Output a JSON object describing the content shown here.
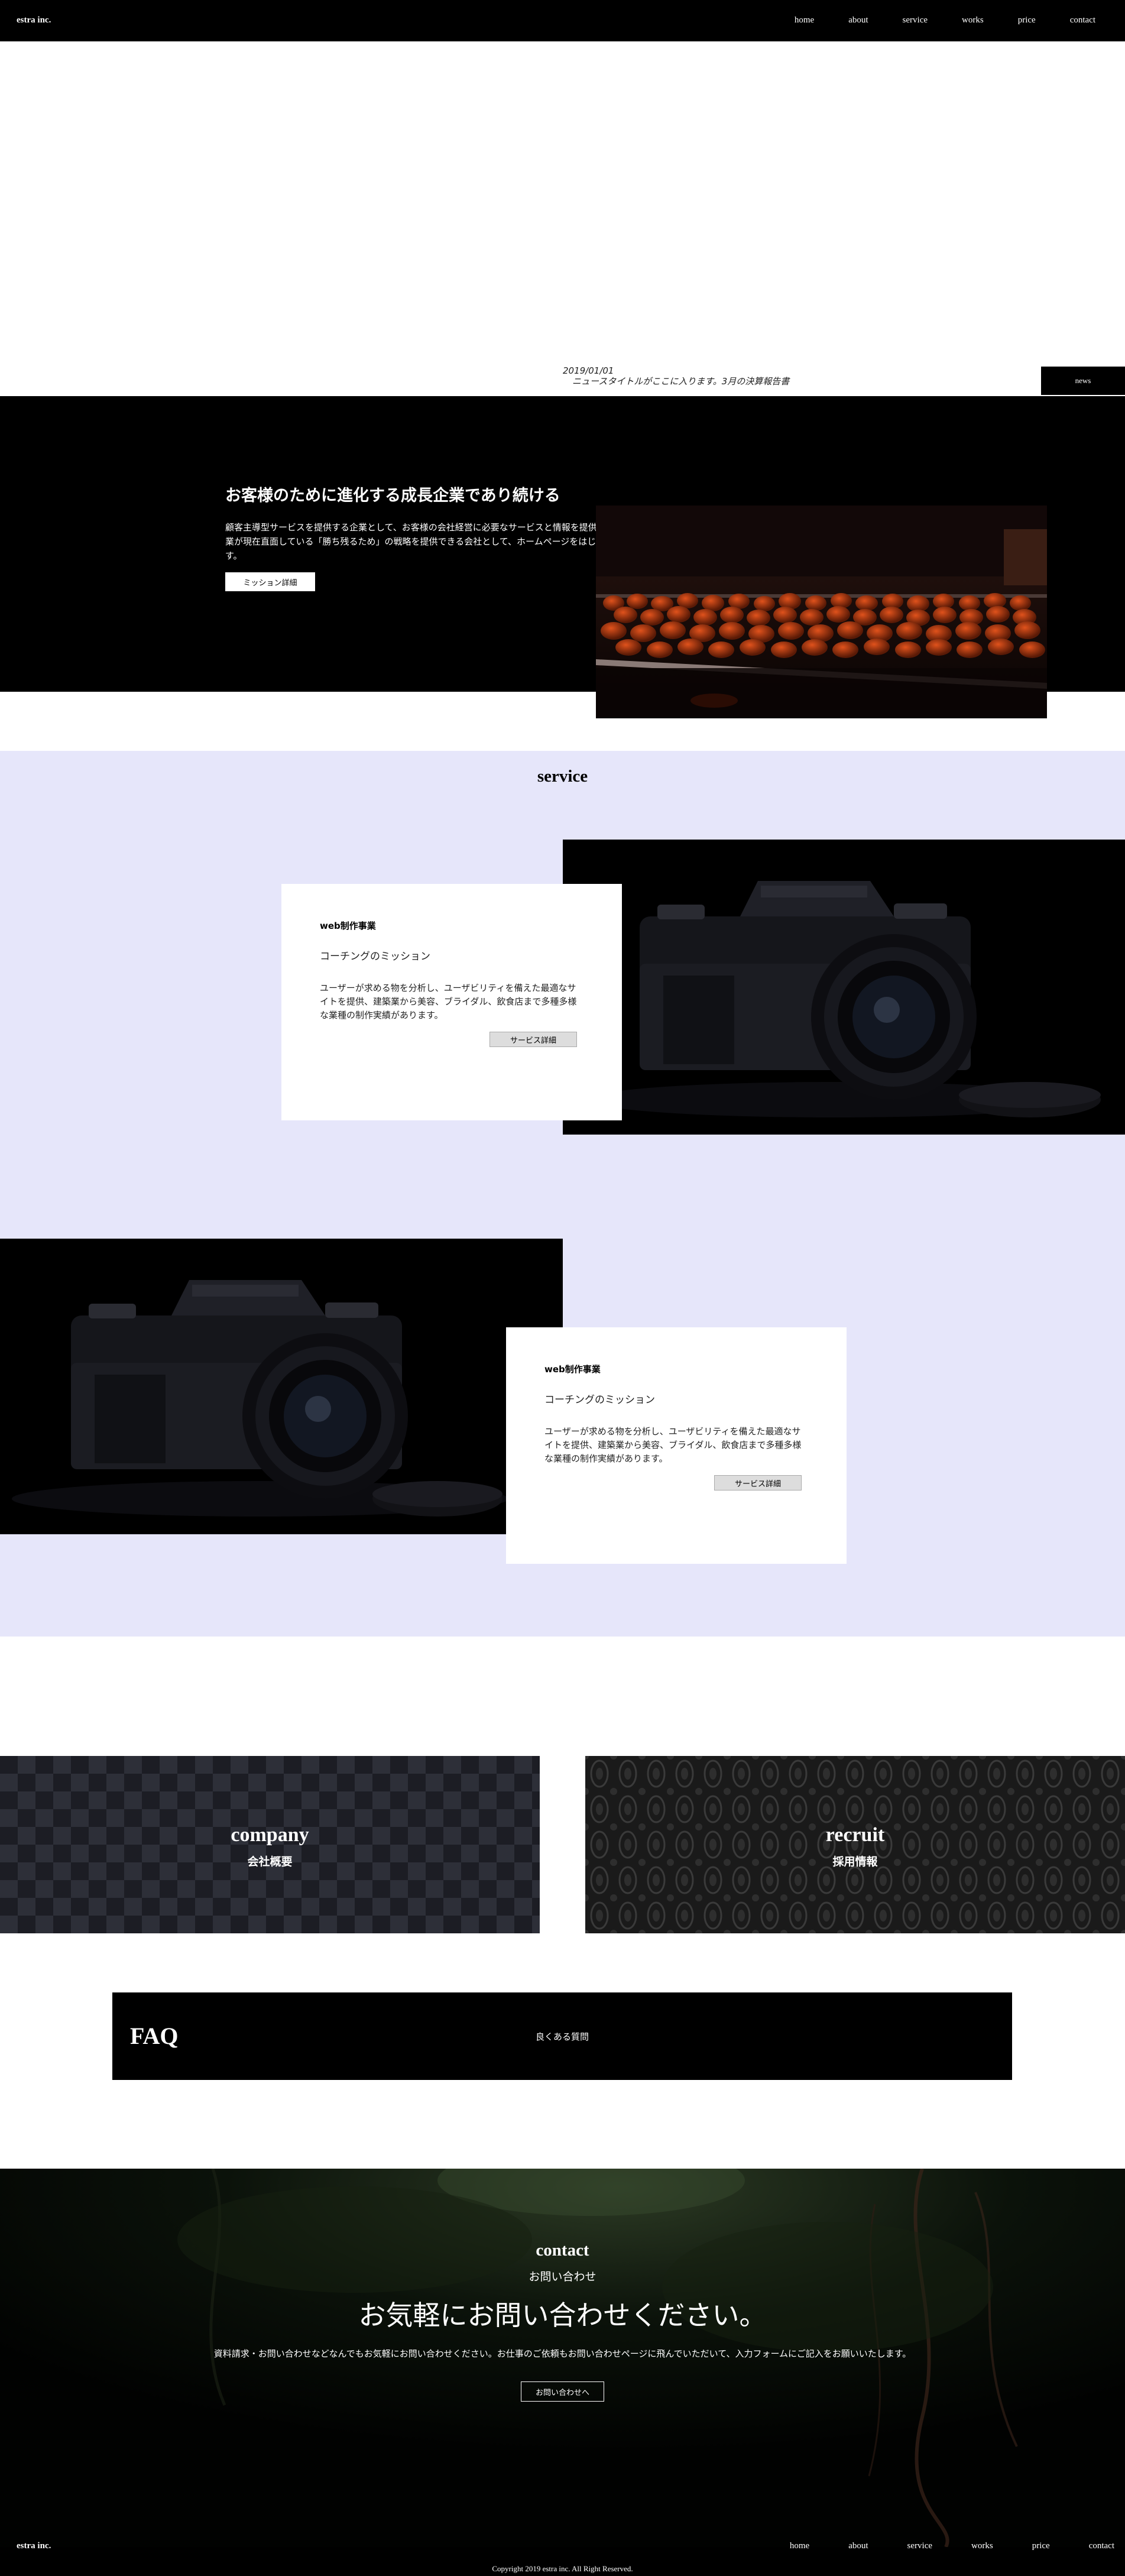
{
  "header": {
    "logo": "estra inc.",
    "nav": [
      "home",
      "about",
      "service",
      "works",
      "price",
      "contact"
    ]
  },
  "news": {
    "date": "2019/01/01",
    "title": "ニュースタイトルがここに入ります。3月の決算報告書",
    "button": "news"
  },
  "mission": {
    "title": "お客様のために進化する成長企業であり続ける",
    "text": "顧客主導型サービスを提供する企業として、お客様の会社経営に必要なサービスと情報を提供し続ける企業支援型会社を目指します。企業が現在直面している「勝ち残るため」の戦略を提供できる会社として、ホームページをはじめ、各種マーケティングをご提供いたします。",
    "button": "ミッション詳細"
  },
  "service": {
    "title": "service",
    "cards": [
      {
        "category": "web制作事業",
        "subtitle": "コーチングのミッション",
        "text": "ユーザーが求める物を分析し、ユーザビリティを備えた最適なサイトを提供、建築業から美容、ブライダル、飲食店まで多種多様な業種の制作実績があります。",
        "button": "サービス詳細"
      },
      {
        "category": "web制作事業",
        "subtitle": "コーチングのミッション",
        "text": "ユーザーが求める物を分析し、ユーザビリティを備えた最適なサイトを提供、建築業から美容、ブライダル、飲食店まで多種多様な業種の制作実績があります。",
        "button": "サービス詳細"
      }
    ]
  },
  "company": {
    "title": "company",
    "subtitle": "会社概要"
  },
  "recruit": {
    "title": "recruit",
    "subtitle": "採用情報"
  },
  "faq": {
    "title": "FAQ",
    "text": "良くある質問"
  },
  "contact": {
    "title": "contact",
    "subtitle": "お問い合わせ",
    "lead": "お気軽にお問い合わせください。",
    "text": "資料請求・お問い合わせなどなんでもお気軽にお問い合わせください。お仕事のご依頼もお問い合わせページに飛んでいただいて、入力フォームにご記入をお願いいたします。",
    "button": "お問い合わせへ"
  },
  "footer": {
    "logo": "estra inc.",
    "nav": [
      "home",
      "about",
      "service",
      "works",
      "price",
      "contact"
    ],
    "copyright": "Copyright 2019 estra inc. All Right Reserved."
  }
}
